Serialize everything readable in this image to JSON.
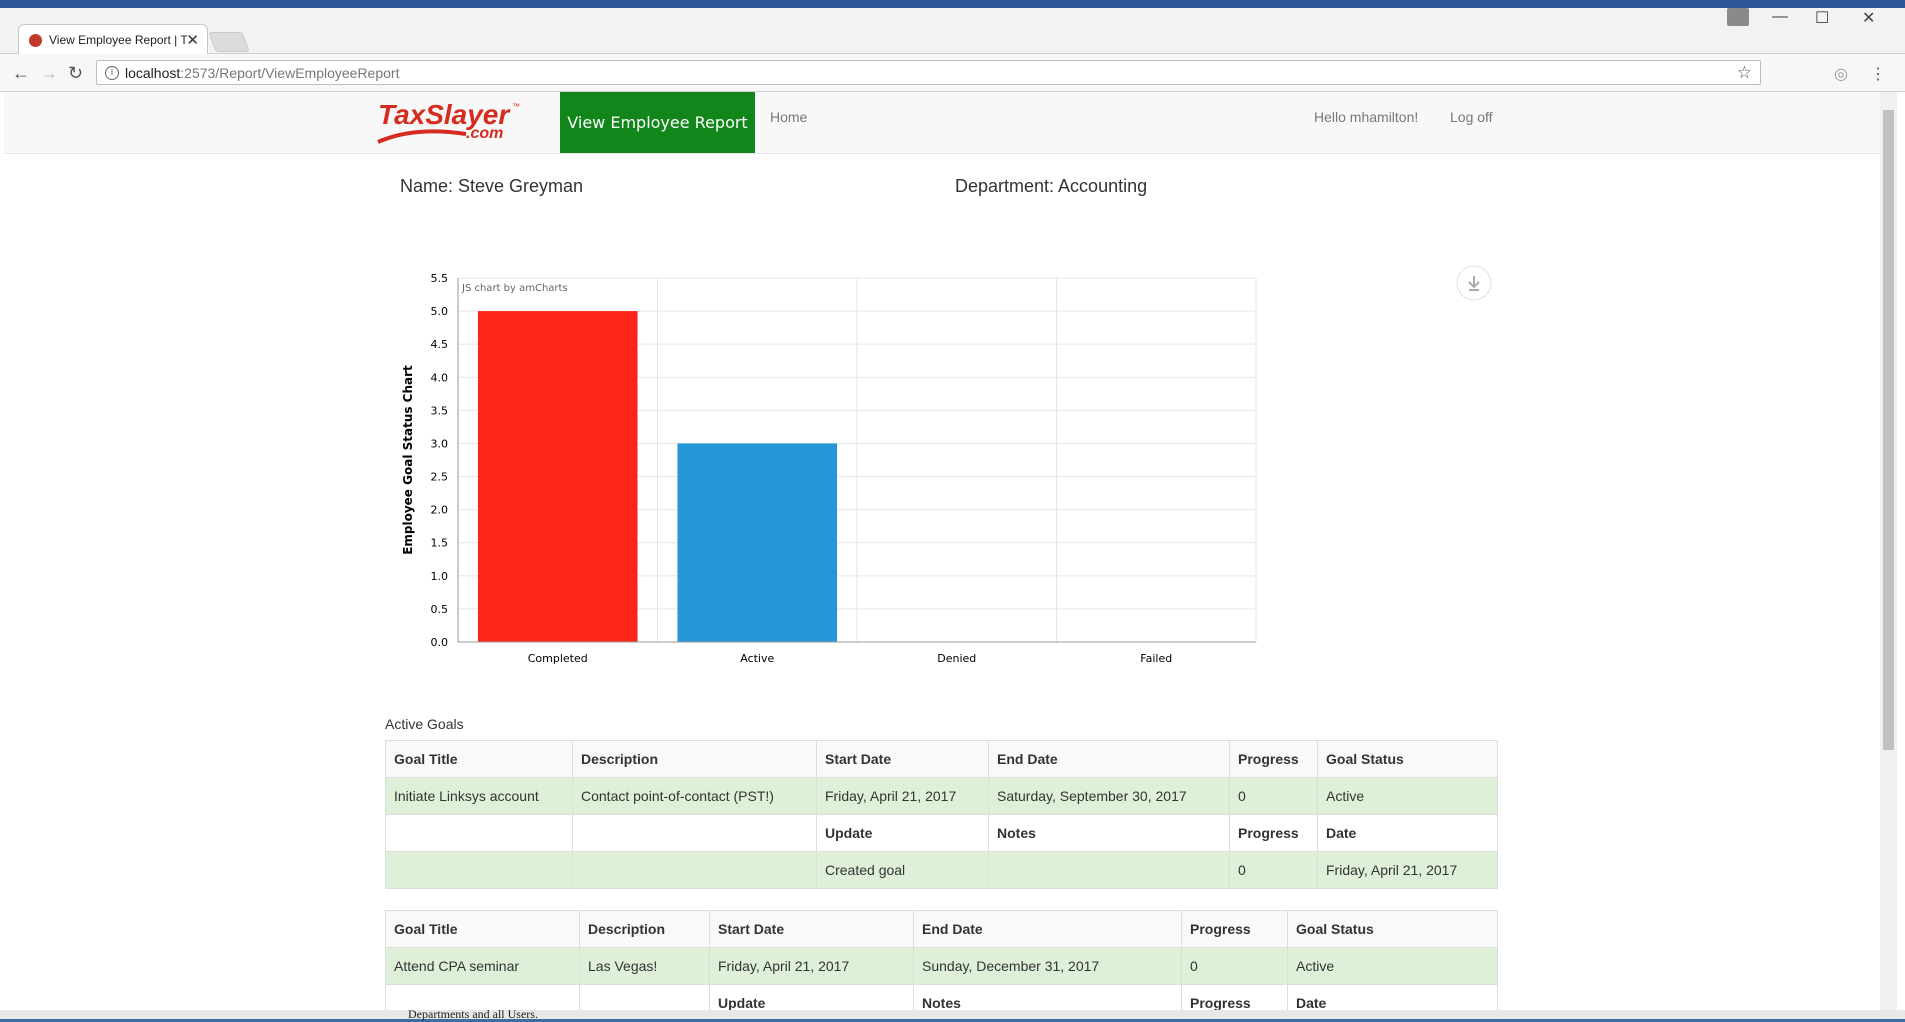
{
  "browser": {
    "tab_title": "View Employee Report | T",
    "url_host": "localhost",
    "url_path": ":2573/Report/ViewEmployeeReport",
    "close_glyph": "✕",
    "minimize_glyph": "—",
    "maximize_glyph": "☐",
    "back_glyph": "←",
    "forward_glyph": "→",
    "reload_glyph": "↻",
    "star_glyph": "☆",
    "menu_glyph": "⋮",
    "info_glyph": "i"
  },
  "navbar": {
    "logo_text": "TaxSlayer",
    "logo_sub": ".com",
    "logo_tm": "™",
    "report_button": "View Employee Report",
    "home": "Home",
    "greeting": "Hello mhamilton!",
    "logoff": "Log off"
  },
  "employee": {
    "name": "Name: Steve Greyman",
    "department": "Department: Accounting"
  },
  "chart_data": {
    "type": "bar",
    "categories": [
      "Completed",
      "Active",
      "Denied",
      "Failed"
    ],
    "values": [
      5,
      3,
      0,
      0
    ],
    "colors": [
      "#ff2418",
      "#2596d6",
      "#2596d6",
      "#2596d6"
    ],
    "ylabel": "Employee Goal Status Chart",
    "ylim": [
      0,
      5.5
    ],
    "yticks": [
      "0.0",
      "0.5",
      "1.0",
      "1.5",
      "2.0",
      "2.5",
      "3.0",
      "3.5",
      "4.0",
      "4.5",
      "5.0",
      "5.5"
    ],
    "watermark": "JS chart by amCharts",
    "grid": true
  },
  "active_goals_title": "Active Goals",
  "goal_headers": [
    "Goal Title",
    "Description",
    "Start Date",
    "End Date",
    "Progress",
    "Goal Status"
  ],
  "update_headers": [
    "Update",
    "Notes",
    "Progress",
    "Date"
  ],
  "goals": [
    {
      "title": "Initiate Linksys account",
      "description": "Contact point-of-contact (PST!)",
      "start": "Friday, April 21, 2017",
      "end": "Saturday, September 30, 2017",
      "progress": "0",
      "status": "Active",
      "update": {
        "update": "Created goal",
        "notes": "",
        "progress": "0",
        "date": "Friday, April 21, 2017"
      }
    },
    {
      "title": "Attend CPA seminar",
      "description": "Las Vegas!",
      "start": "Friday, April 21, 2017",
      "end": "Sunday, December 31, 2017",
      "progress": "0",
      "status": "Active"
    }
  ],
  "background_text": "Departments and all Users."
}
